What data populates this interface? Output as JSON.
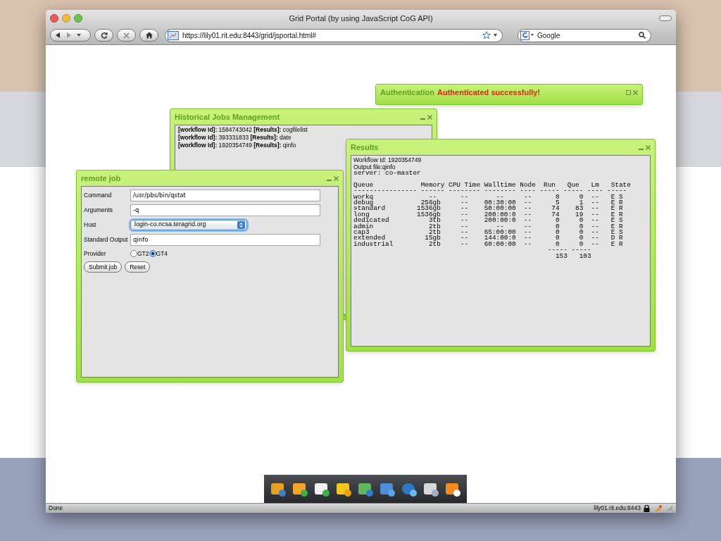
{
  "window": {
    "title": "Grid Portal (by using JavaScript CoG API)"
  },
  "toolbar": {
    "url": "https://lily01.rit.edu:8443/grid/jsportal.html#",
    "search": {
      "placeholder": "Google"
    }
  },
  "authentication": {
    "title": "Authentication",
    "message": "Authenticated successfully!"
  },
  "history": {
    "title": "Historical Jobs Management",
    "entries": [
      "**[workflow Id]:** 1584743042 **[Results]:** cogfilelist",
      "**[workflow Id]:** 393331833 **[Results]:** date",
      "**[workflow Id]:** 1920354749 **[Results]:** qinfo"
    ]
  },
  "results": {
    "title": "Results",
    "workflow": "Workflow Id: 1920354749",
    "output_file": "Output file:qinfo",
    "lines": [
      "server: co-master",
      "Queue            Memory CPU Time Walltime Node  Run   Que   Lm   State",
      "---------------- ------ -------- -------- ---- ----- ----- ---- -----",
      "workq              --      --       --     --      0     0  --   E S",
      "debug            256gb     --    00:30:00  --      5     1  --   E R",
      "standard        1536gb     --    50:00:00  --     74    83  --   E R",
      "long            1536gb     --    200:00:0  --     74    19  --   E R",
      "dedicated          3tb     --    200:00:0  --      0     0  --   E S",
      "admin              2tb     --       --     --      0     0  --   E R",
      "cap3               2tb     --    65:00:00  --      0     0  --   E S",
      "extended          15gb     --    144:00:0  --      0     0  --   D R",
      "industrial         2tb     --    60:00:00  --      0     0  --   E R",
      "                                                 ----- -----",
      "                                                   153   103"
    ]
  },
  "remote_job": {
    "title": "remote job",
    "fields": [
      {
        "label": "Command",
        "kind": "text",
        "value": "/usr/pbs/bin/qstat"
      },
      {
        "label": "Arguments",
        "kind": "text",
        "value": "-q"
      },
      {
        "label": "Host",
        "kind": "select",
        "value": "login-co.ncsa.teragrid.org"
      },
      {
        "label": "Standard Output",
        "kind": "text",
        "value": "qinfo"
      }
    ],
    "provider": {
      "label": "Provider",
      "options": [
        {
          "label": "GT2",
          "selected": false
        },
        {
          "label": "GT4",
          "selected": true
        }
      ]
    },
    "buttons": [
      "Submit job",
      "Reset"
    ]
  },
  "status_bar": {
    "status": "Done",
    "host": "lily01.rit.edu:8443"
  }
}
